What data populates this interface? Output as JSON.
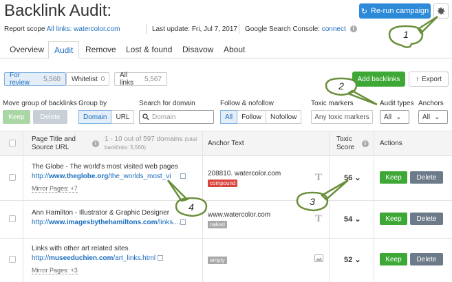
{
  "header": {
    "title": "Backlink Audit:",
    "rerun_label": "Re-run campaign"
  },
  "meta": {
    "scope_label": "Report scope",
    "scope_link": "All links: watercolor.com",
    "update": "Last update: Fri, Jul 7, 2017",
    "gsc_label": "Google Search Console:",
    "gsc_link": "connect"
  },
  "tabs": [
    {
      "label": "Overview"
    },
    {
      "label": "Audit"
    },
    {
      "label": "Remove"
    },
    {
      "label": "Lost & found"
    },
    {
      "label": "Disavow"
    },
    {
      "label": "About"
    }
  ],
  "segments": [
    {
      "label": "For review",
      "count": "5,560"
    },
    {
      "label": "Whitelist",
      "count": "0"
    },
    {
      "label": "All links",
      "count": "5,567"
    }
  ],
  "actions": {
    "add_label": "Add backlinks",
    "export_label": "Export"
  },
  "filters": {
    "move_label": "Move group of backlinks",
    "keep_label": "Keep",
    "delete_label": "Delete",
    "group_label": "Group by",
    "group_options": [
      "Domain",
      "URL"
    ],
    "search_label": "Search for domain",
    "search_placeholder": "Domain",
    "follow_label": "Follow & nofollow",
    "follow_options": [
      "All",
      "Follow",
      "Nofollow"
    ],
    "toxic_label": "Toxic markers",
    "toxic_value": "Any toxic markers",
    "audit_label": "Audit types",
    "audit_value": "All",
    "anchors_label": "Anchors",
    "anchors_value": "All"
  },
  "table": {
    "col_page": "Page Title and Source URL",
    "count_text": "1 - 10 out of 597 domains",
    "count_sub": "(total backlinks: 5,560)",
    "col_anchor": "Anchor Text",
    "col_toxic": "Toxic Score",
    "col_actions": "Actions",
    "keep_label": "Keep",
    "delete_label": "Delete",
    "rows": [
      {
        "title": "The Globe - The world's most visited web pages",
        "url_prefix": "http://",
        "url_domain": "www.theglobe.org",
        "url_rest": "/the_worlds_most_vi",
        "mirror": "Mirror Pages: +7",
        "anchor": "208810. watercolor.com",
        "tag": "compound",
        "score": "56"
      },
      {
        "title": "Ann Hamilton - Illustrator & Graphic Designer",
        "url_prefix": "http://",
        "url_domain": "www.imagesbythehamiltons.com",
        "url_rest": "/links....",
        "mirror": "",
        "anchor": "www.watercolor.com",
        "tag": "naked",
        "score": "54"
      },
      {
        "title": "Links with other art related sites",
        "url_prefix": "http://",
        "url_domain": "museeduchien.com",
        "url_rest": "/art_links.html",
        "mirror": "Mirror Pages: +3",
        "anchor": "",
        "tag": "empty",
        "score": "52"
      }
    ]
  },
  "callouts": [
    "1",
    "2",
    "3",
    "4"
  ],
  "colors": {
    "accent": "#2d8ad9",
    "green": "#3ea837",
    "gray_btn": "#6c7a89",
    "callout_fill": "#ffffff",
    "callout_border": "#6a8f3a"
  }
}
